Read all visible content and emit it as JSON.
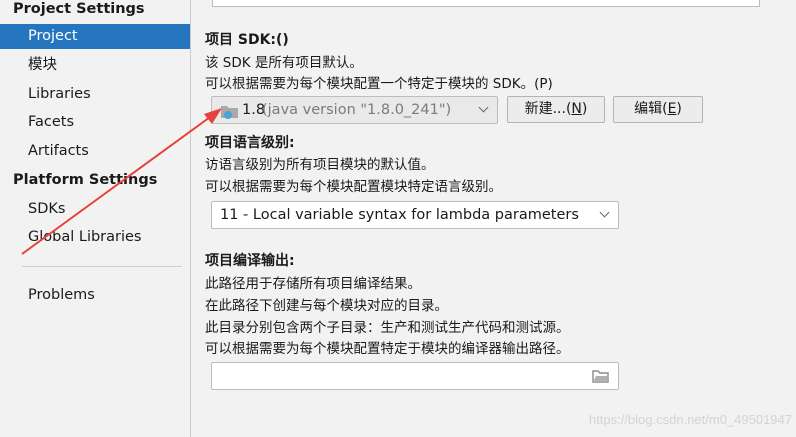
{
  "sidebar": {
    "project_settings_header": "Project Settings",
    "project_items": [
      "Project",
      "模块",
      "Libraries",
      "Facets",
      "Artifacts"
    ],
    "platform_settings_header": "Platform Settings",
    "platform_items": [
      "SDKs",
      "Global Libraries"
    ],
    "problems": "Problems",
    "selected": "Project"
  },
  "sdk": {
    "title": "项目 SDK:()",
    "desc1": "该 SDK 是所有项目默认。",
    "desc2": "可以根据需要为每个模块配置一个特定于模块的 SDK。(P)",
    "combo_version": "1.8",
    "combo_detail": " (java version \"1.8.0_241\")",
    "new_button_prefix": "新建...(",
    "new_button_key": "N",
    "new_button_suffix": ")",
    "edit_button_prefix": "编辑(",
    "edit_button_key": "E",
    "edit_button_suffix": ")"
  },
  "language": {
    "title": "项目语言级别:",
    "desc1": "访语言级别为所有项目模块的默认值。",
    "desc2": "可以根据需要为每个模块配置模块特定语言级别。",
    "selected_level": "11 - Local variable syntax for lambda parameters"
  },
  "output": {
    "title": "项目编译输出:",
    "desc1": "此路径用于存储所有项目编译结果。",
    "desc2": "在此路径下创建与每个模块对应的目录。",
    "desc3": "此目录分别包含两个子目录：生产和测试生产代码和测试源。",
    "desc4": "可以根据需要为每个模块配置特定于模块的编译器输出路径。",
    "path_value": ""
  },
  "watermark": "https://blog.csdn.net/m0_49501947",
  "colors": {
    "selection": "#2675bf",
    "annotation_arrow": "#e8403a"
  }
}
